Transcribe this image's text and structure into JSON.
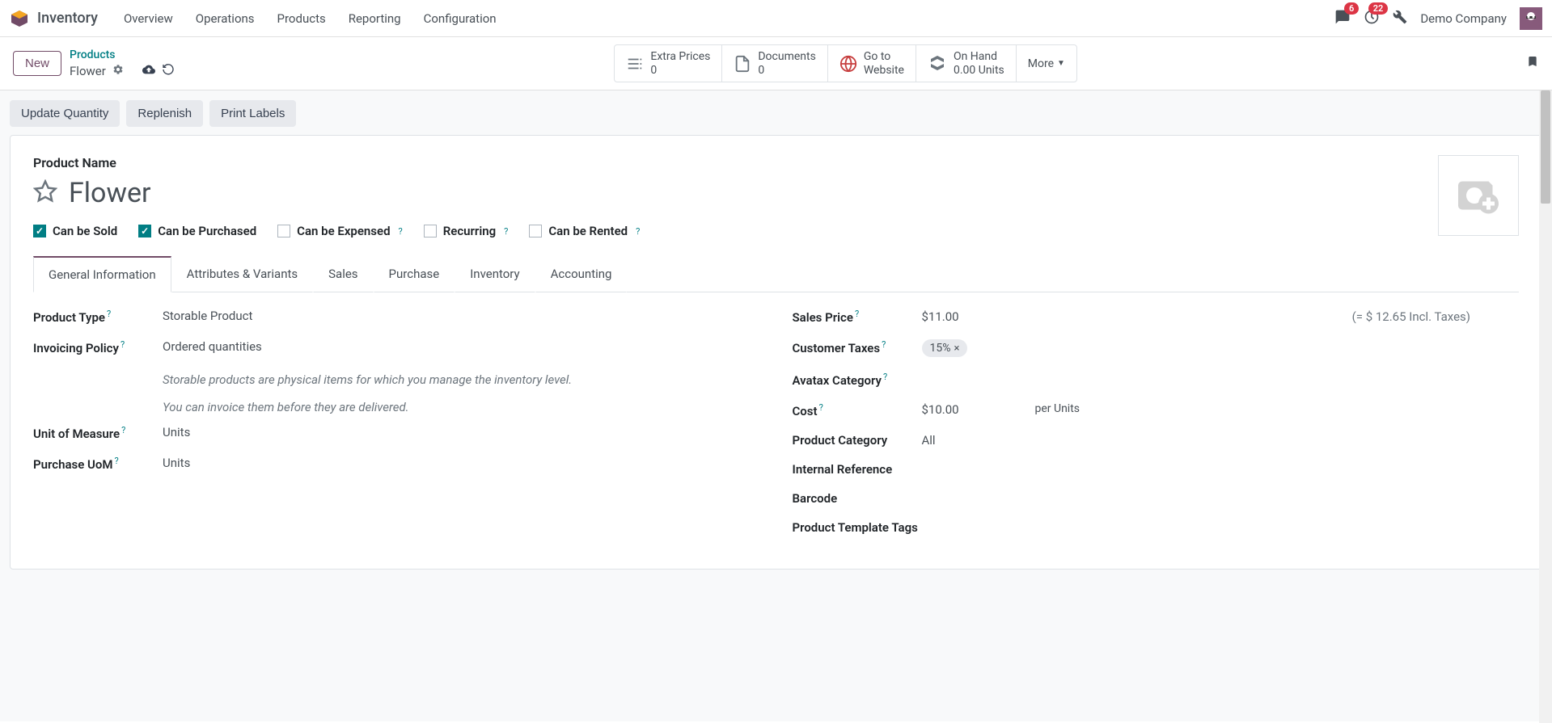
{
  "app": {
    "title": "Inventory"
  },
  "nav": {
    "items": [
      "Overview",
      "Operations",
      "Products",
      "Reporting",
      "Configuration"
    ]
  },
  "header": {
    "badges": {
      "messages": "6",
      "activities": "22"
    },
    "company": "Demo Company"
  },
  "cpanel": {
    "new_label": "New",
    "breadcrumb_parent": "Products",
    "breadcrumb_current": "Flower",
    "stats": {
      "extra_prices": {
        "label": "Extra Prices",
        "value": "0"
      },
      "documents": {
        "label": "Documents",
        "value": "0"
      },
      "website": {
        "line1": "Go to",
        "line2": "Website"
      },
      "onhand": {
        "label": "On Hand",
        "value": "0.00 Units"
      },
      "more": "More"
    }
  },
  "actions": {
    "update_qty": "Update Quantity",
    "replenish": "Replenish",
    "print_labels": "Print Labels"
  },
  "form": {
    "product_name_label": "Product Name",
    "product_name": "Flower",
    "checks": {
      "sold": "Can be Sold",
      "purchased": "Can be Purchased",
      "expensed": "Can be Expensed",
      "recurring": "Recurring",
      "rented": "Can be Rented"
    },
    "tabs": [
      "General Information",
      "Attributes & Variants",
      "Sales",
      "Purchase",
      "Inventory",
      "Accounting"
    ],
    "left": {
      "product_type_label": "Product Type",
      "product_type": "Storable Product",
      "invoicing_policy_label": "Invoicing Policy",
      "invoicing_policy": "Ordered quantities",
      "help1": "Storable products are physical items for which you manage the inventory level.",
      "help2": "You can invoice them before they are delivered.",
      "uom_label": "Unit of Measure",
      "uom": "Units",
      "purchase_uom_label": "Purchase UoM",
      "purchase_uom": "Units"
    },
    "right": {
      "sales_price_label": "Sales Price",
      "sales_price": "$11.00",
      "sales_price_incl": "(= $ 12.65 Incl. Taxes)",
      "customer_taxes_label": "Customer Taxes",
      "customer_taxes_tag": "15%",
      "avatax_label": "Avatax Category",
      "cost_label": "Cost",
      "cost": "$10.00",
      "cost_units": "per Units",
      "category_label": "Product Category",
      "category": "All",
      "internal_ref_label": "Internal Reference",
      "barcode_label": "Barcode",
      "tags_label": "Product Template Tags"
    }
  }
}
